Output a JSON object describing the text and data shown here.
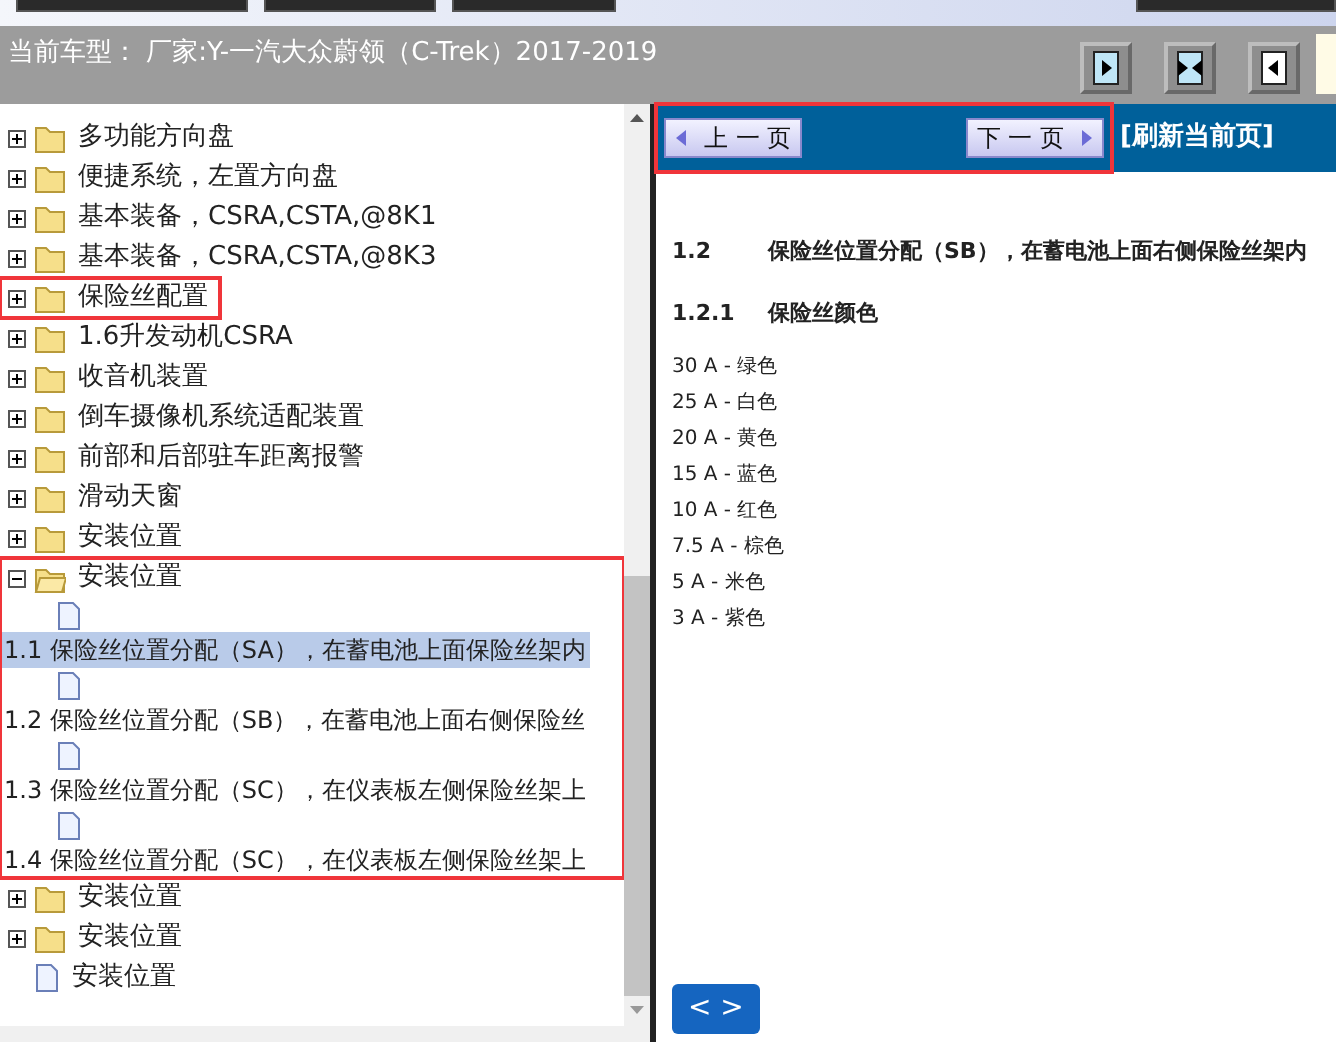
{
  "header": {
    "title": "当前车型：  厂家:Y-一汽大众蔚领（C-Trek）2017-2019",
    "buttons": [
      {
        "kind": "right"
      },
      {
        "kind": "both"
      },
      {
        "kind": "left"
      }
    ]
  },
  "tree": [
    {
      "kind": "folder",
      "label": "多功能方向盘",
      "expanded": false,
      "selected": false,
      "highlighted": false
    },
    {
      "kind": "folder",
      "label": "便捷系统，左置方向盘",
      "expanded": false,
      "selected": false,
      "highlighted": false
    },
    {
      "kind": "folder",
      "label": "基本装备，CSRA,CSTA,@8K1",
      "expanded": false,
      "selected": false,
      "highlighted": false
    },
    {
      "kind": "folder",
      "label": "基本装备，CSRA,CSTA,@8K3",
      "expanded": false,
      "selected": false,
      "highlighted": false
    },
    {
      "kind": "folder",
      "label": "保险丝配置",
      "expanded": false,
      "selected": false,
      "highlighted": true
    },
    {
      "kind": "folder",
      "label": "1.6升发动机CSRA",
      "expanded": false,
      "selected": false,
      "highlighted": false
    },
    {
      "kind": "folder",
      "label": "收音机装置",
      "expanded": false,
      "selected": false,
      "highlighted": false
    },
    {
      "kind": "folder",
      "label": "倒车摄像机系统适配装置",
      "expanded": false,
      "selected": false,
      "highlighted": false
    },
    {
      "kind": "folder",
      "label": "前部和后部驻车距离报警",
      "expanded": false,
      "selected": false,
      "highlighted": false
    },
    {
      "kind": "folder",
      "label": "滑动天窗",
      "expanded": false,
      "selected": false,
      "highlighted": false
    },
    {
      "kind": "folder",
      "label": "安装位置",
      "expanded": false,
      "selected": false,
      "highlighted": false
    },
    {
      "kind": "folder",
      "label": "安装位置",
      "expanded": true,
      "selected": false,
      "highlighted": true,
      "children": [
        {
          "kind": "page",
          "label": "1.1 保险丝位置分配（SA），在蓄电池上面保险丝架内",
          "selected": true
        },
        {
          "kind": "page",
          "label": "1.2 保险丝位置分配（SB），在蓄电池上面右侧保险丝",
          "selected": false
        },
        {
          "kind": "page",
          "label": "1.3 保险丝位置分配（SC），在仪表板左侧保险丝架上",
          "selected": false
        },
        {
          "kind": "page",
          "label": "1.4 保险丝位置分配（SC），在仪表板左侧保险丝架上",
          "selected": false
        }
      ]
    },
    {
      "kind": "folder",
      "label": "安装位置",
      "expanded": false,
      "selected": false,
      "highlighted": false
    },
    {
      "kind": "folder",
      "label": "安装位置",
      "expanded": false,
      "selected": false,
      "highlighted": false
    },
    {
      "kind": "page",
      "label": "安装位置",
      "selected": false,
      "highlighted": false
    }
  ],
  "nav": {
    "prev": "上 一 页",
    "next": "下 一 页",
    "refresh": "[刷新当前页]",
    "highlighted": true
  },
  "document": {
    "heading": {
      "number": "1.2",
      "text": "保险丝位置分配（SB），在蓄电池上面右侧保险丝架内"
    },
    "subheading": {
      "number": "1.2.1",
      "text": "保险丝颜色"
    },
    "fuses": [
      "30 A - 绿色",
      "25 A - 白色",
      "20 A - 黄色",
      "15 A - 蓝色",
      "10 A - 红色",
      "7.5 A - 棕色",
      "5 A - 米色",
      "3 A - 紫色"
    ]
  },
  "pager_button": "< >"
}
